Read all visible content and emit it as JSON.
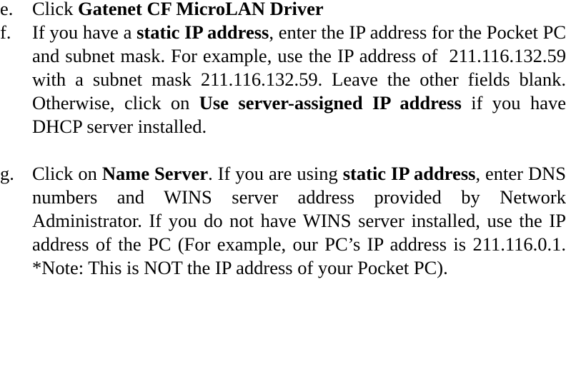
{
  "document": {
    "type": "instruction-list",
    "list_style": "lower-alpha",
    "text_align": "justify",
    "colors": {
      "text": "#000000",
      "background": "#ffffff"
    },
    "items": [
      {
        "marker": "e.",
        "id": "step-e",
        "runs": [
          {
            "text": "Click ",
            "bold": false
          },
          {
            "text": "Gatenet CF MicroLAN Driver",
            "bold": true
          }
        ],
        "plain_text": "Click Gatenet CF MicroLAN Driver"
      },
      {
        "marker": "f.",
        "id": "step-f",
        "runs": [
          {
            "text": "If you have a ",
            "bold": false
          },
          {
            "text": "static IP address",
            "bold": true
          },
          {
            "text": ", enter the IP address for the Pocket PC and subnet mask. For example, use the IP address of  211.116.132.59 with a subnet mask 211.116.132.59. Leave the other fields blank. Otherwise, click on ",
            "bold": false
          },
          {
            "text": "Use server-assigned IP address",
            "bold": true
          },
          {
            "text": " if you have DHCP server installed.",
            "bold": false
          }
        ],
        "plain_text": "If you have a static IP address, enter the IP address for the Pocket PC and subnet mask. For example, use the IP address of 211.116.132.59 with a subnet mask 211.116.132.59. Leave the other fields blank. Otherwise, click on Use server-assigned IP address if you have DHCP server installed."
      },
      {
        "marker": "g.",
        "id": "step-g",
        "runs": [
          {
            "text": "Click on ",
            "bold": false
          },
          {
            "text": "Name Server",
            "bold": true
          },
          {
            "text": ". If you are using ",
            "bold": false
          },
          {
            "text": "static IP address",
            "bold": true
          },
          {
            "text": ", enter DNS numbers and WINS server address provided by Network Administrator. If you do not have WINS server installed, use the IP address of the PC (For example, our PC’s IP address is 211.116.0.1. *Note: This is NOT the IP address of your Pocket PC).",
            "bold": false
          }
        ],
        "plain_text": "Click on Name Server. If you are using static IP address, enter DNS numbers and WINS server address provided by Network Administrator. If you do not have WINS server installed, use the IP address of the PC (For example, our PC’s IP address is 211.116.0.1. *Note: This is NOT the IP address of your Pocket PC)."
      }
    ],
    "referenced_values": {
      "static_ip_address": "211.116.132.59",
      "subnet_mask": "211.116.132.59",
      "pc_ip_address": "211.116.0.1",
      "driver_name": "Gatenet CF MicroLAN Driver",
      "dhcp_option_label": "Use server-assigned IP address",
      "name_server_tab": "Name Server",
      "note_marker": "*Note:"
    }
  }
}
